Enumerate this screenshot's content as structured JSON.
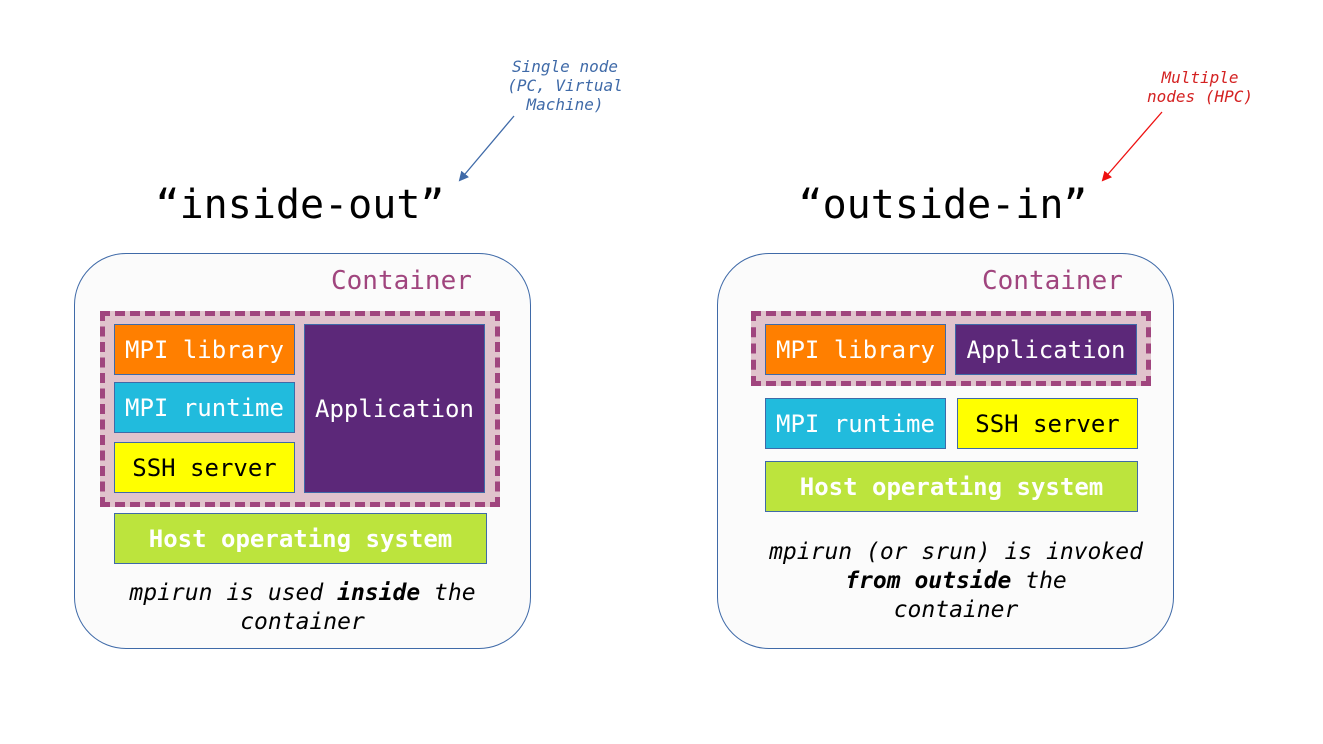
{
  "annotations": {
    "left": {
      "lines": [
        "Single node",
        "(PC, Virtual",
        "Machine)"
      ],
      "color": "#3f6aa8"
    },
    "right": {
      "lines": [
        "Multiple",
        "nodes (HPC)"
      ],
      "color": "#d42222"
    }
  },
  "left_panel": {
    "title": "“inside-out”",
    "container_label": "Container",
    "boxes": {
      "mpi_library": "MPI library",
      "mpi_runtime": "MPI runtime",
      "ssh_server": "SSH server",
      "application": "Application",
      "host_os": "Host operating system"
    },
    "caption": {
      "pre": "mpirun is used ",
      "bold": "inside",
      "post": " the",
      "line2": "container"
    }
  },
  "right_panel": {
    "title": "“outside-in”",
    "container_label": "Container",
    "boxes": {
      "mpi_library": "MPI library",
      "application": "Application",
      "mpi_runtime": "MPI runtime",
      "ssh_server": "SSH server",
      "host_os": "Host operating system"
    },
    "caption": {
      "line1": "mpirun (or srun) is invoked",
      "bold": "from outside",
      "post": " the",
      "line3": "container"
    }
  },
  "colors": {
    "mpi_library": "#ff7f00",
    "mpi_runtime": "#21bbdd",
    "ssh_server": "#ffff00",
    "application": "#5c2879",
    "host_os": "#bce43d",
    "container_accent": "#a0457e",
    "panel_border": "#3f6aa8"
  }
}
